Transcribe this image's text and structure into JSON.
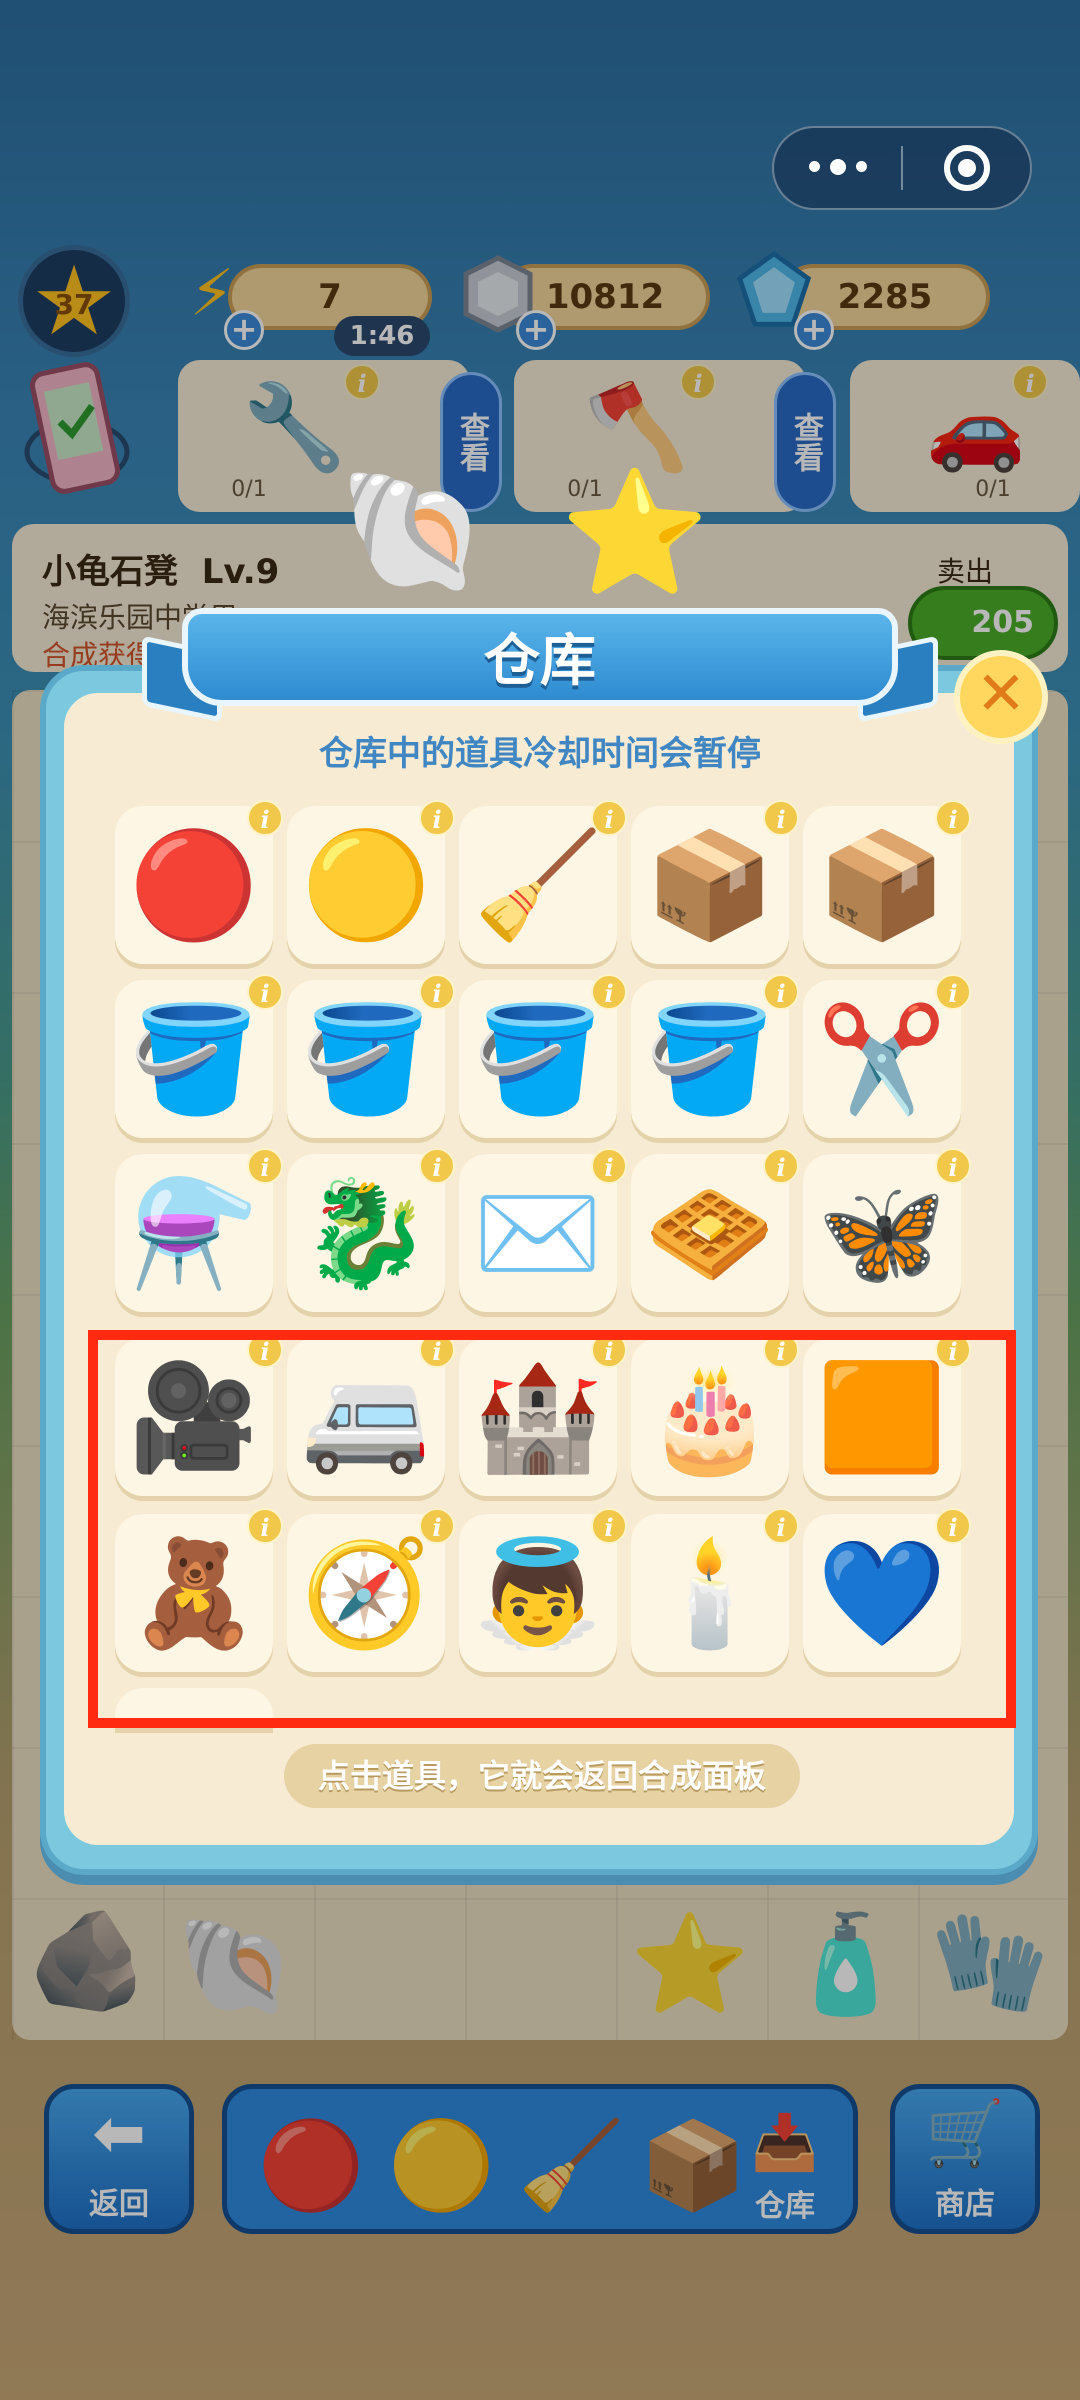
{
  "top_bar": {
    "level": "37",
    "energy": "7",
    "energy_timer": "1:46",
    "coins": "10812",
    "gems": "2285"
  },
  "orders": [
    {
      "icon": "drill-icon",
      "count": "0/1",
      "check_label": "查看"
    },
    {
      "icon": "axe-icon",
      "count": "0/1",
      "check_label": "查看"
    },
    {
      "icon": "car-icon",
      "count": "0/1"
    }
  ],
  "info_strip": {
    "name": "小龟石凳",
    "level": "Lv.9",
    "location": "海滨乐园中堂巴",
    "merge_text": "合成获得",
    "sell_label": "卖出",
    "sell_value": "205"
  },
  "modal": {
    "title": "仓库",
    "subtitle": "仓库中的道具冷却时间会暂停",
    "hint": "点击道具，它就会返回合成面板",
    "close": "✕",
    "info_glyph": "i",
    "items": [
      {
        "name": "red-energy-orb",
        "glyph": "🔴"
      },
      {
        "name": "gold-energy-orb",
        "glyph": "🟡"
      },
      {
        "name": "vacuum-cleaner",
        "glyph": "🧹"
      },
      {
        "name": "cement-bags",
        "glyph": "📦"
      },
      {
        "name": "cement-bags",
        "glyph": "📦"
      },
      {
        "name": "paint-bucket",
        "glyph": "🪣"
      },
      {
        "name": "paint-bucket",
        "glyph": "🪣"
      },
      {
        "name": "paint-bucket",
        "glyph": "🪣"
      },
      {
        "name": "paint-bucket",
        "glyph": "🪣"
      },
      {
        "name": "scissors-orb",
        "glyph": "✂️"
      },
      {
        "name": "distillery",
        "glyph": "⚗️"
      },
      {
        "name": "dragon-boat",
        "glyph": "🐉"
      },
      {
        "name": "envelope",
        "glyph": "✉️"
      },
      {
        "name": "woven-mat",
        "glyph": "🧇"
      },
      {
        "name": "rainbow-butterfly",
        "glyph": "🦋"
      },
      {
        "name": "film-projector",
        "glyph": "🎥"
      },
      {
        "name": "camper-van",
        "glyph": "🚐"
      },
      {
        "name": "fairy-castle-book",
        "glyph": "🏰"
      },
      {
        "name": "cake-table",
        "glyph": "🎂"
      },
      {
        "name": "shipping-container",
        "glyph": "🟧"
      },
      {
        "name": "toy-box",
        "glyph": "🧸"
      },
      {
        "name": "compass",
        "glyph": "🧭"
      },
      {
        "name": "cupid-statue",
        "glyph": "👼"
      },
      {
        "name": "candelabra",
        "glyph": "🕯️"
      },
      {
        "name": "heart-necklace",
        "glyph": "💙"
      }
    ]
  },
  "bottom_bar": {
    "back_label": "返回",
    "warehouse_label": "仓库",
    "shop_label": "商店"
  },
  "colors": {
    "highlight": "#ff2a10",
    "modal_border": "#7cc8df",
    "panel": "#f7ecd3",
    "tip_text": "#3f86c2"
  }
}
